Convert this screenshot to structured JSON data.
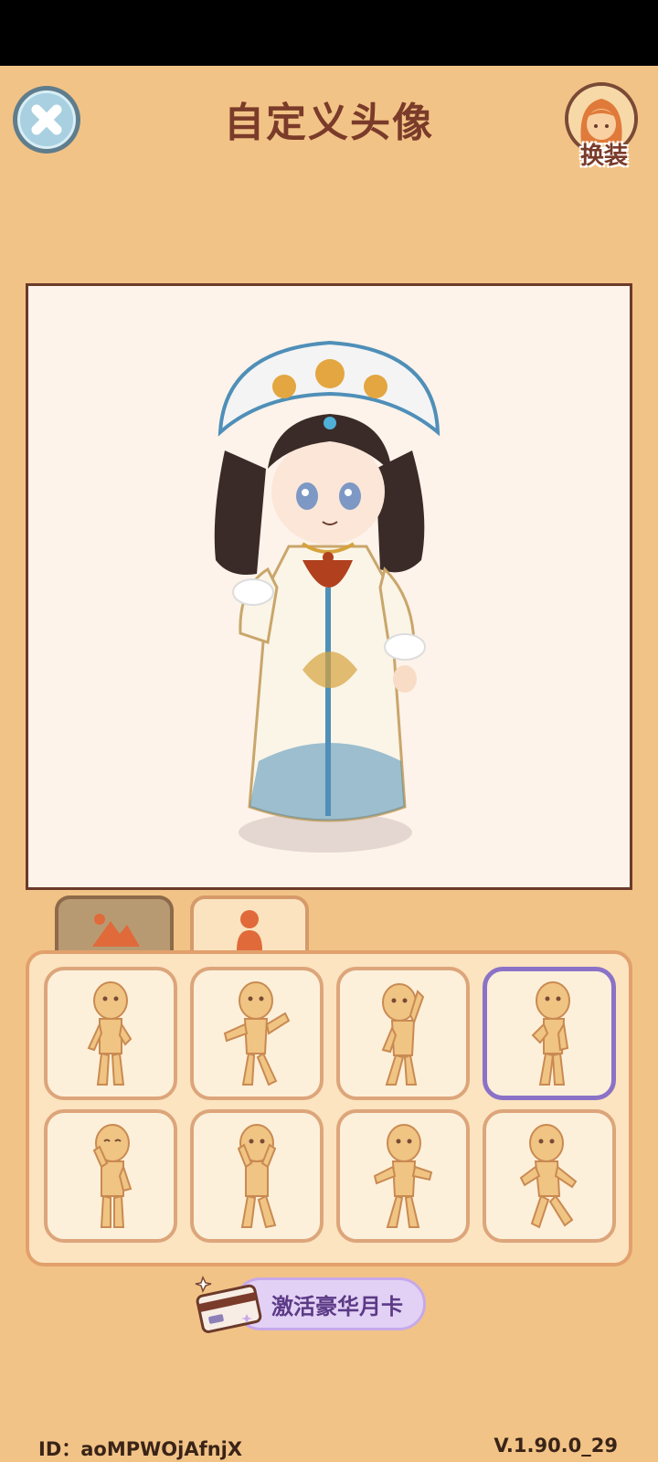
{
  "header": {
    "title": "自定义头像",
    "dressup_label": "换装"
  },
  "tabs": [
    {
      "name": "background",
      "icon": "mountain-icon",
      "active": false
    },
    {
      "name": "pose",
      "icon": "person-icon",
      "active": true
    }
  ],
  "poses": [
    {
      "id": 1,
      "selected": false
    },
    {
      "id": 2,
      "selected": false
    },
    {
      "id": 3,
      "selected": false
    },
    {
      "id": 4,
      "selected": true
    },
    {
      "id": 5,
      "selected": false
    },
    {
      "id": 6,
      "selected": false
    },
    {
      "id": 7,
      "selected": false
    },
    {
      "id": 8,
      "selected": false
    }
  ],
  "promo": {
    "label": "激活豪华月卡"
  },
  "footer": {
    "id_text": "ID：aoMPWOjAfnjX",
    "version": "V.1.90.0_29"
  },
  "colors": {
    "background": "#f2c386",
    "title": "#7a3b2a",
    "selected_border": "#8b72c7"
  }
}
